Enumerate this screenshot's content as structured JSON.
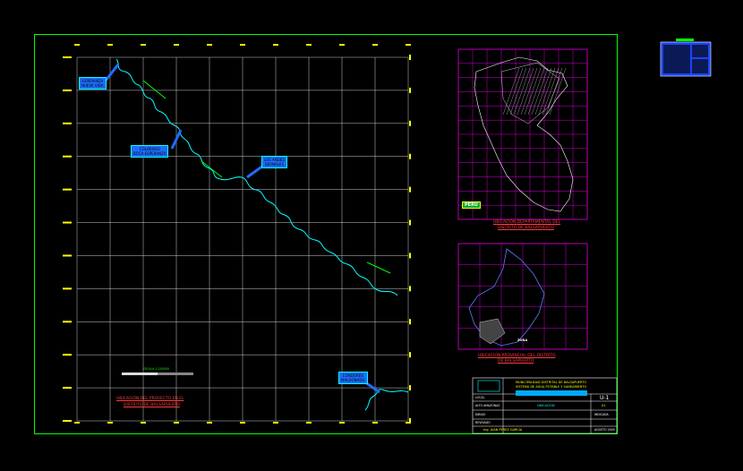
{
  "colors": {
    "background": "#000000",
    "frame": "#00ff00",
    "grid": "#ffffff",
    "river": "#00ffff",
    "tick": "#ffff00",
    "label_fill": "#1f6dff",
    "map_grid": "#ff00ff",
    "title_red": "#ff3b3b"
  },
  "main_map": {
    "labels": [
      {
        "id": "lbl1",
        "text": "ESPERANZA\nNUEVA VIDA"
      },
      {
        "id": "lbl2",
        "text": "COLORADO\nBOCA ESPERANZA"
      },
      {
        "id": "lbl3",
        "text": "LOS ANDES\nBERNALES"
      },
      {
        "id": "lbl4",
        "text": "CONDORES\nMALDONADO"
      }
    ],
    "scale_text": "ESCALA 1:250000",
    "title_line1": "UBICACIÓN DEL PROYECTO EN EL",
    "title_line2": "DISTRITO DE BALSAPUERTO"
  },
  "peru_map": {
    "box_label": "PERU",
    "title_line1": "UBICACIÓN DEPARTAMENTAL DEL",
    "title_line2": "DISTRITO DE BALSAPUERTO"
  },
  "district_map": {
    "label": "ZONA",
    "title_line1": "UBICACIÓN PROVINCIAL DEL DISTRITO",
    "title_line2": "DE BALSAPUERTO"
  },
  "title_block": {
    "org": "MUNICIPALIDAD DISTRITAL DE BALSAPUERTO",
    "project": "SISTEMA DE AGUA POTABLE Y SANEAMIENTO",
    "sheet_title": "UBICACIÓN",
    "sheet_code": "U-1",
    "sheet_num": "01",
    "scale": "INDICADA",
    "date": "AGOSTO 2009",
    "row_labels": [
      "LOCAL",
      "ALTO AMAZONAS",
      "DIBUJO",
      "REVISADO"
    ],
    "drawn_by": "Ing. JUAN PEREZ GARCIA"
  }
}
